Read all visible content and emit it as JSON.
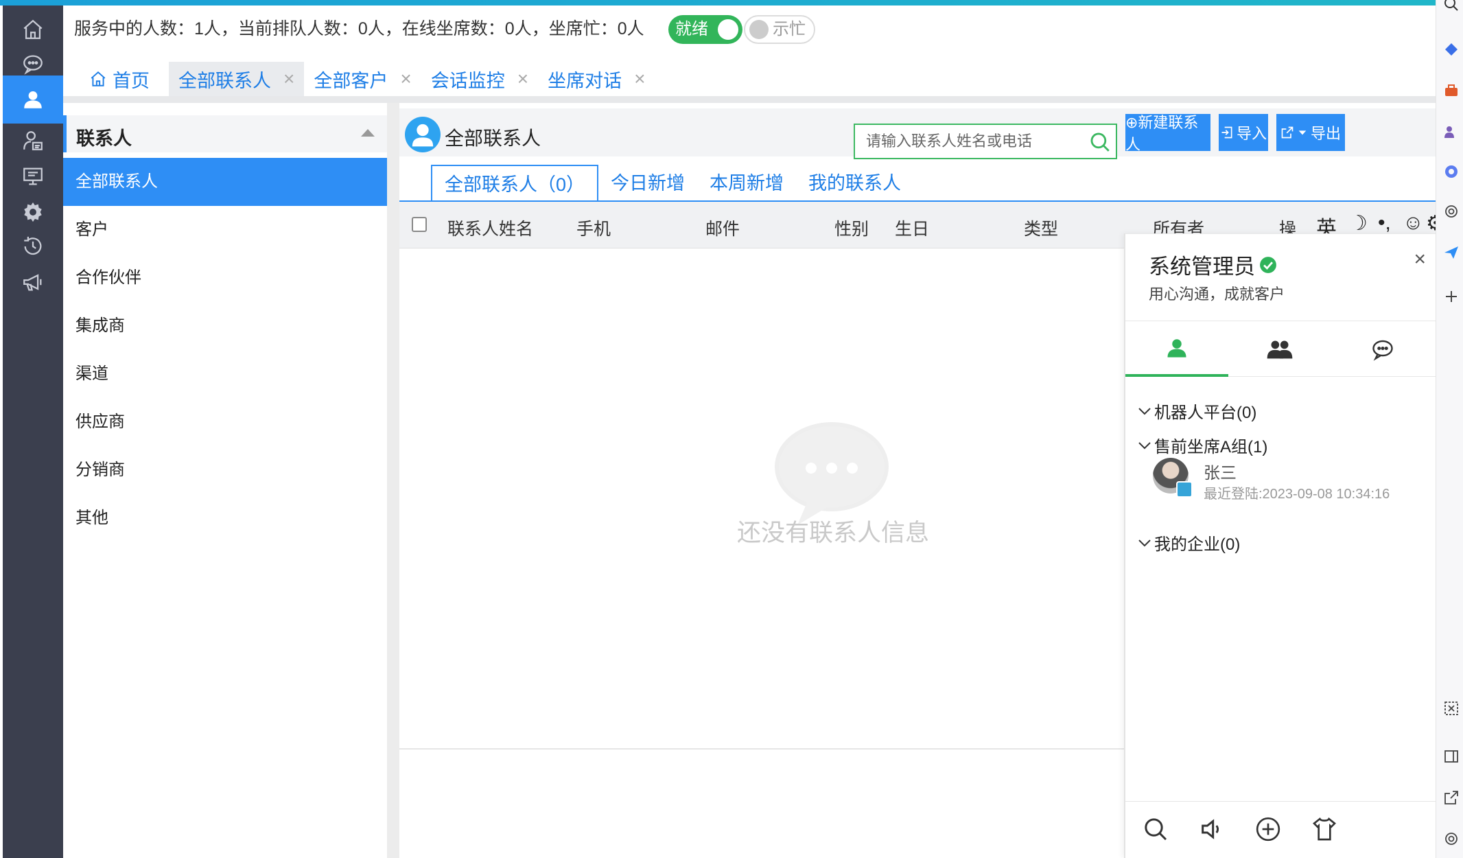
{
  "status": {
    "text": "服务中的人数：1人，当前排队人数：0人，在线坐席数：0人，坐席忙：0人",
    "ready_label": "就绪",
    "busy_label": "示忙"
  },
  "page_tabs": [
    {
      "label": "首页",
      "icon": "home-icon",
      "closable": false
    },
    {
      "label": "全部联系人",
      "closable": true,
      "active": true
    },
    {
      "label": "全部客户",
      "closable": true
    },
    {
      "label": "会话监控",
      "closable": true
    },
    {
      "label": "坐席对话",
      "closable": true
    }
  ],
  "tab_close_glyph": "×",
  "sidebar": {
    "title": "联系人",
    "items": [
      "全部联系人",
      "客户",
      "合作伙伴",
      "集成商",
      "渠道",
      "供应商",
      "分销商",
      "其他"
    ],
    "active_index": 0
  },
  "main": {
    "title": "全部联系人",
    "search_placeholder": "请输入联系人姓名或电话",
    "buttons": {
      "new": "⊕新建联系人",
      "import": "导入",
      "export": "导出"
    },
    "subtabs": [
      "全部联系人（0）",
      "今日新增",
      "本周新增",
      "我的联系人"
    ],
    "columns": [
      "联系人姓名",
      "手机",
      "邮件",
      "性别",
      "生日",
      "类型",
      "所有者",
      "操"
    ],
    "input_toolbar": [
      "英",
      "☽",
      "•,",
      "☺",
      "⚙"
    ],
    "empty_text": "还没有联系人信息"
  },
  "chat_panel": {
    "name": "系统管理员",
    "motto": "用心沟通，成就客户",
    "close_glyph": "×",
    "groups": [
      {
        "label": "机器人平台(0)"
      },
      {
        "label": "售前坐席A组(1)"
      },
      {
        "label": "我的企业(0)"
      }
    ],
    "member": {
      "name": "张三",
      "last_login": "最近登陆:2023-09-08 10:34:16"
    }
  },
  "colors": {
    "primary": "#2e8ef5",
    "rail_bg": "#3b3f4e",
    "ready_green": "#32b55a",
    "link_blue": "#1e7ee6"
  }
}
